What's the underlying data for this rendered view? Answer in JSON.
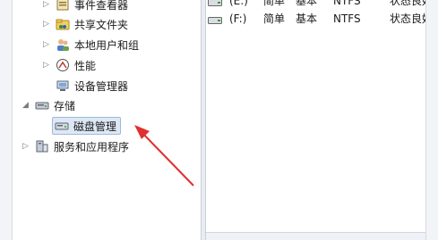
{
  "tree": {
    "items": [
      {
        "label": "事件查看器",
        "icon": "event-viewer-icon"
      },
      {
        "label": "共享文件夹",
        "icon": "shared-folders-icon"
      },
      {
        "label": "本地用户和组",
        "icon": "local-users-groups-icon"
      },
      {
        "label": "性能",
        "icon": "performance-icon"
      },
      {
        "label": "设备管理器",
        "icon": "device-manager-icon"
      },
      {
        "label": "存储",
        "icon": "storage-icon"
      },
      {
        "label": "磁盘管理",
        "icon": "disk-management-icon"
      },
      {
        "label": "服务和应用程序",
        "icon": "services-applications-icon"
      }
    ]
  },
  "volumes": [
    {
      "name": "(E:)",
      "layout": "简单",
      "type": "基本",
      "fs": "NTFS",
      "status": "状态良好"
    },
    {
      "name": "(F:)",
      "layout": "简单",
      "type": "基本",
      "fs": "NTFS",
      "status": "状态良好"
    }
  ],
  "colors": {
    "selection": "#dde8f5",
    "selection_border": "#9fb8d8",
    "arrow": "#e03030"
  }
}
